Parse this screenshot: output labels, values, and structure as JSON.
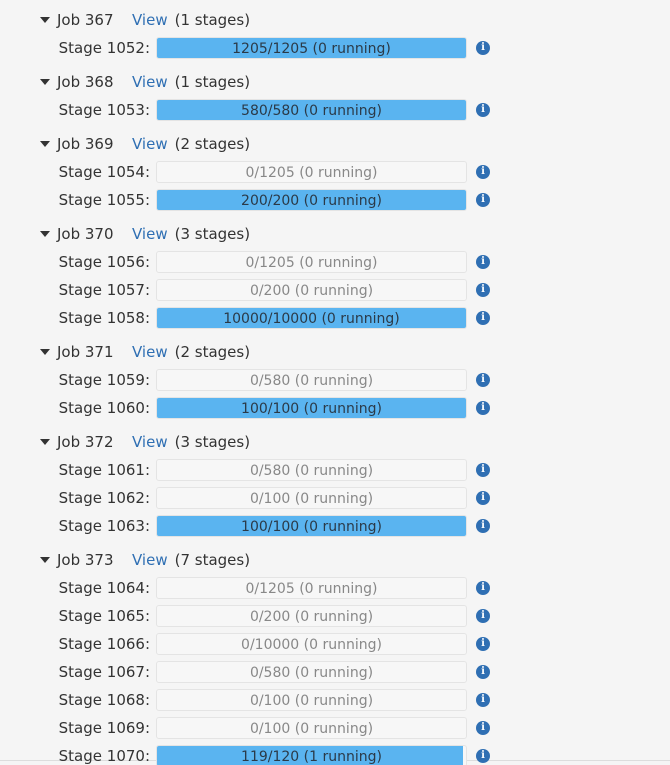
{
  "view_label": "View",
  "info_glyph": "i",
  "accent_color": "#5ab4f0",
  "jobs": [
    {
      "name": "Job 367",
      "stage_count": "(1 stages)",
      "stages": [
        {
          "label": "Stage 1052:",
          "text": "1205/1205 (0 running)",
          "progress": 1.0
        }
      ]
    },
    {
      "name": "Job 368",
      "stage_count": "(1 stages)",
      "stages": [
        {
          "label": "Stage 1053:",
          "text": "580/580 (0 running)",
          "progress": 1.0
        }
      ]
    },
    {
      "name": "Job 369",
      "stage_count": "(2 stages)",
      "stages": [
        {
          "label": "Stage 1054:",
          "text": "0/1205 (0 running)",
          "progress": 0
        },
        {
          "label": "Stage 1055:",
          "text": "200/200 (0 running)",
          "progress": 1.0
        }
      ]
    },
    {
      "name": "Job 370",
      "stage_count": "(3 stages)",
      "stages": [
        {
          "label": "Stage 1056:",
          "text": "0/1205 (0 running)",
          "progress": 0
        },
        {
          "label": "Stage 1057:",
          "text": "0/200 (0 running)",
          "progress": 0
        },
        {
          "label": "Stage 1058:",
          "text": "10000/10000 (0 running)",
          "progress": 1.0
        }
      ]
    },
    {
      "name": "Job 371",
      "stage_count": "(2 stages)",
      "stages": [
        {
          "label": "Stage 1059:",
          "text": "0/580 (0 running)",
          "progress": 0
        },
        {
          "label": "Stage 1060:",
          "text": "100/100 (0 running)",
          "progress": 1.0
        }
      ]
    },
    {
      "name": "Job 372",
      "stage_count": "(3 stages)",
      "stages": [
        {
          "label": "Stage 1061:",
          "text": "0/580 (0 running)",
          "progress": 0
        },
        {
          "label": "Stage 1062:",
          "text": "0/100 (0 running)",
          "progress": 0
        },
        {
          "label": "Stage 1063:",
          "text": "100/100 (0 running)",
          "progress": 1.0
        }
      ]
    },
    {
      "name": "Job 373",
      "stage_count": "(7 stages)",
      "stages": [
        {
          "label": "Stage 1064:",
          "text": "0/1205 (0 running)",
          "progress": 0
        },
        {
          "label": "Stage 1065:",
          "text": "0/200 (0 running)",
          "progress": 0
        },
        {
          "label": "Stage 1066:",
          "text": "0/10000 (0 running)",
          "progress": 0
        },
        {
          "label": "Stage 1067:",
          "text": "0/580 (0 running)",
          "progress": 0
        },
        {
          "label": "Stage 1068:",
          "text": "0/100 (0 running)",
          "progress": 0
        },
        {
          "label": "Stage 1069:",
          "text": "0/100 (0 running)",
          "progress": 0
        },
        {
          "label": "Stage 1070:",
          "text": "119/120 (1 running)",
          "progress": 0.9917
        }
      ]
    }
  ]
}
